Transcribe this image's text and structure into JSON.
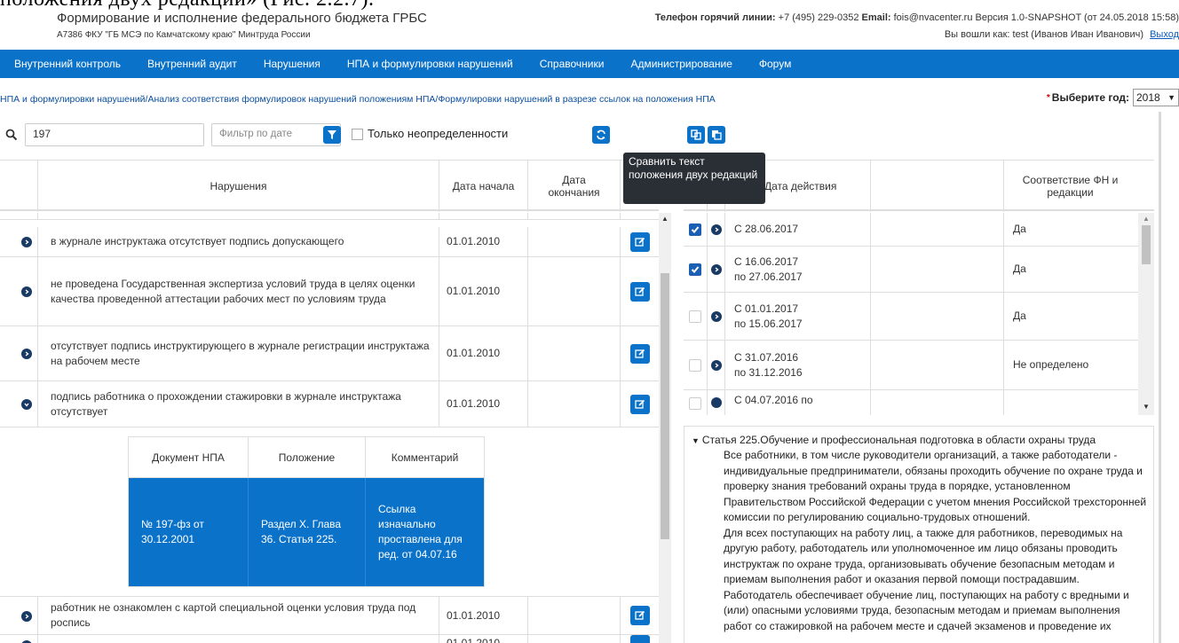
{
  "caption": "положения двух редакций» (Рис. 2.2.7).",
  "header": {
    "title": "Формирование и исполнение федерального бюджета ГРБС",
    "subtitle": "А7386 ФКУ \"ГБ МСЭ по Камчатскому краю\" Минтруда России",
    "hotline_label": "Телефон горячий линии:",
    "hotline": "+7 (495) 229-0352",
    "email_label": "Email:",
    "email": "fois@nvacenter.ru",
    "version": "Версия 1.0-SNAPSHOT (от 24.05.2018 15:58)",
    "logged_in": "Вы вошли как:  test  (Иванов Иван Иванович)",
    "logout": "Выход"
  },
  "nav": {
    "items": [
      "Внутренний контроль",
      "Внутренний аудит",
      "Нарушения",
      "НПА и формулировки нарушений",
      "Справочники",
      "Администрирование",
      "Форум"
    ]
  },
  "breadcrumb": "НПА и формулировки нарушений/Анализ соответствия формулировок нарушений положениям НПА/Формулировки нарушений в разрезе ссылок на положения НПА",
  "year": {
    "label": "Выберите год:",
    "value": "2018"
  },
  "filters": {
    "search_value": "197",
    "date_placeholder": "Фильтр по дате",
    "only_undefined": "Только неопределенности"
  },
  "tooltip": "Сравнить текст положения двух редакций",
  "left_table": {
    "headers": {
      "violation": "Нарушения",
      "start": "Дата начала",
      "end": "Дата окончания"
    },
    "rows": [
      {
        "text": "в журнале инструктажа отсутствует подпись допускающего",
        "start": "01.01.2010"
      },
      {
        "text": "не проведена Государственная экспертиза условий труда в целях оценки качества проведенной аттестации рабочих мест по условиям труда",
        "start": "01.01.2010"
      },
      {
        "text": "отсутствует подпись инструктирующего в журнале регистрации инструктажа на рабочем месте",
        "start": "01.01.2010"
      },
      {
        "text": "подпись работника о прохождении стажировки в журнале инструктажа отсутствует",
        "start": "01.01.2010"
      },
      {
        "text": "работник не ознакомлен с картой специальной оценки условия труда под роспись",
        "start": "01.01.2010"
      },
      {
        "text": "",
        "start": "01.01.2010"
      }
    ],
    "nested": {
      "headers": [
        "Документ НПА",
        "Положение",
        "Комментарий"
      ],
      "row": [
        "№ 197-фз от 30.12.2001",
        "Раздел X. Глава 36. Статья 225.",
        "Ссылка изначально проставлена для ред. от 04.07.16"
      ]
    }
  },
  "right_table": {
    "headers": {
      "action_date": "Дата действия",
      "match": "Соответствие ФН и редакции"
    },
    "rows": [
      {
        "checked": true,
        "date": "С 28.06.2017",
        "match": "Да"
      },
      {
        "checked": true,
        "date": "С 16.06.2017 по 27.06.2017",
        "match": "Да"
      },
      {
        "checked": false,
        "date": "С 01.01.2017 по 15.06.2017",
        "match": "Да"
      },
      {
        "checked": false,
        "date": "С 31.07.2016 по 31.12.2016",
        "match": "Не определено"
      },
      {
        "checked": false,
        "date": "С 04.07.2016 по",
        "match": ""
      }
    ]
  },
  "article": {
    "title": "Статья 225.Обучение и профессиональная подготовка в области охраны труда",
    "text": "Все работники, в том числе руководители организаций, а также работодатели - индивидуальные предприниматели, обязаны проходить обучение по охране труда и проверку знания требований охраны труда в порядке, установленном Правительством Российской Федерации с учетом мнения Российской трехсторонней комиссии по регулированию социально-трудовых отношений.\nДля всех поступающих на работу лиц, а также для работников, переводимых на другую работу, работодатель или уполномоченное им лицо обязаны проводить инструктаж по охране труда, организовывать обучение безопасным методам и приемам выполнения работ и оказания первой помощи пострадавшим.\nРаботодатель обеспечивает обучение лиц, поступающих на работу с вредными и (или) опасными условиями труда, безопасным методам и приемам выполнения работ со стажировкой на рабочем месте и сдачей экзаменов и проведение их"
  },
  "colors": {
    "primary": "#0b72c9",
    "header_text": "#333333",
    "link": "#0a5bbf"
  }
}
